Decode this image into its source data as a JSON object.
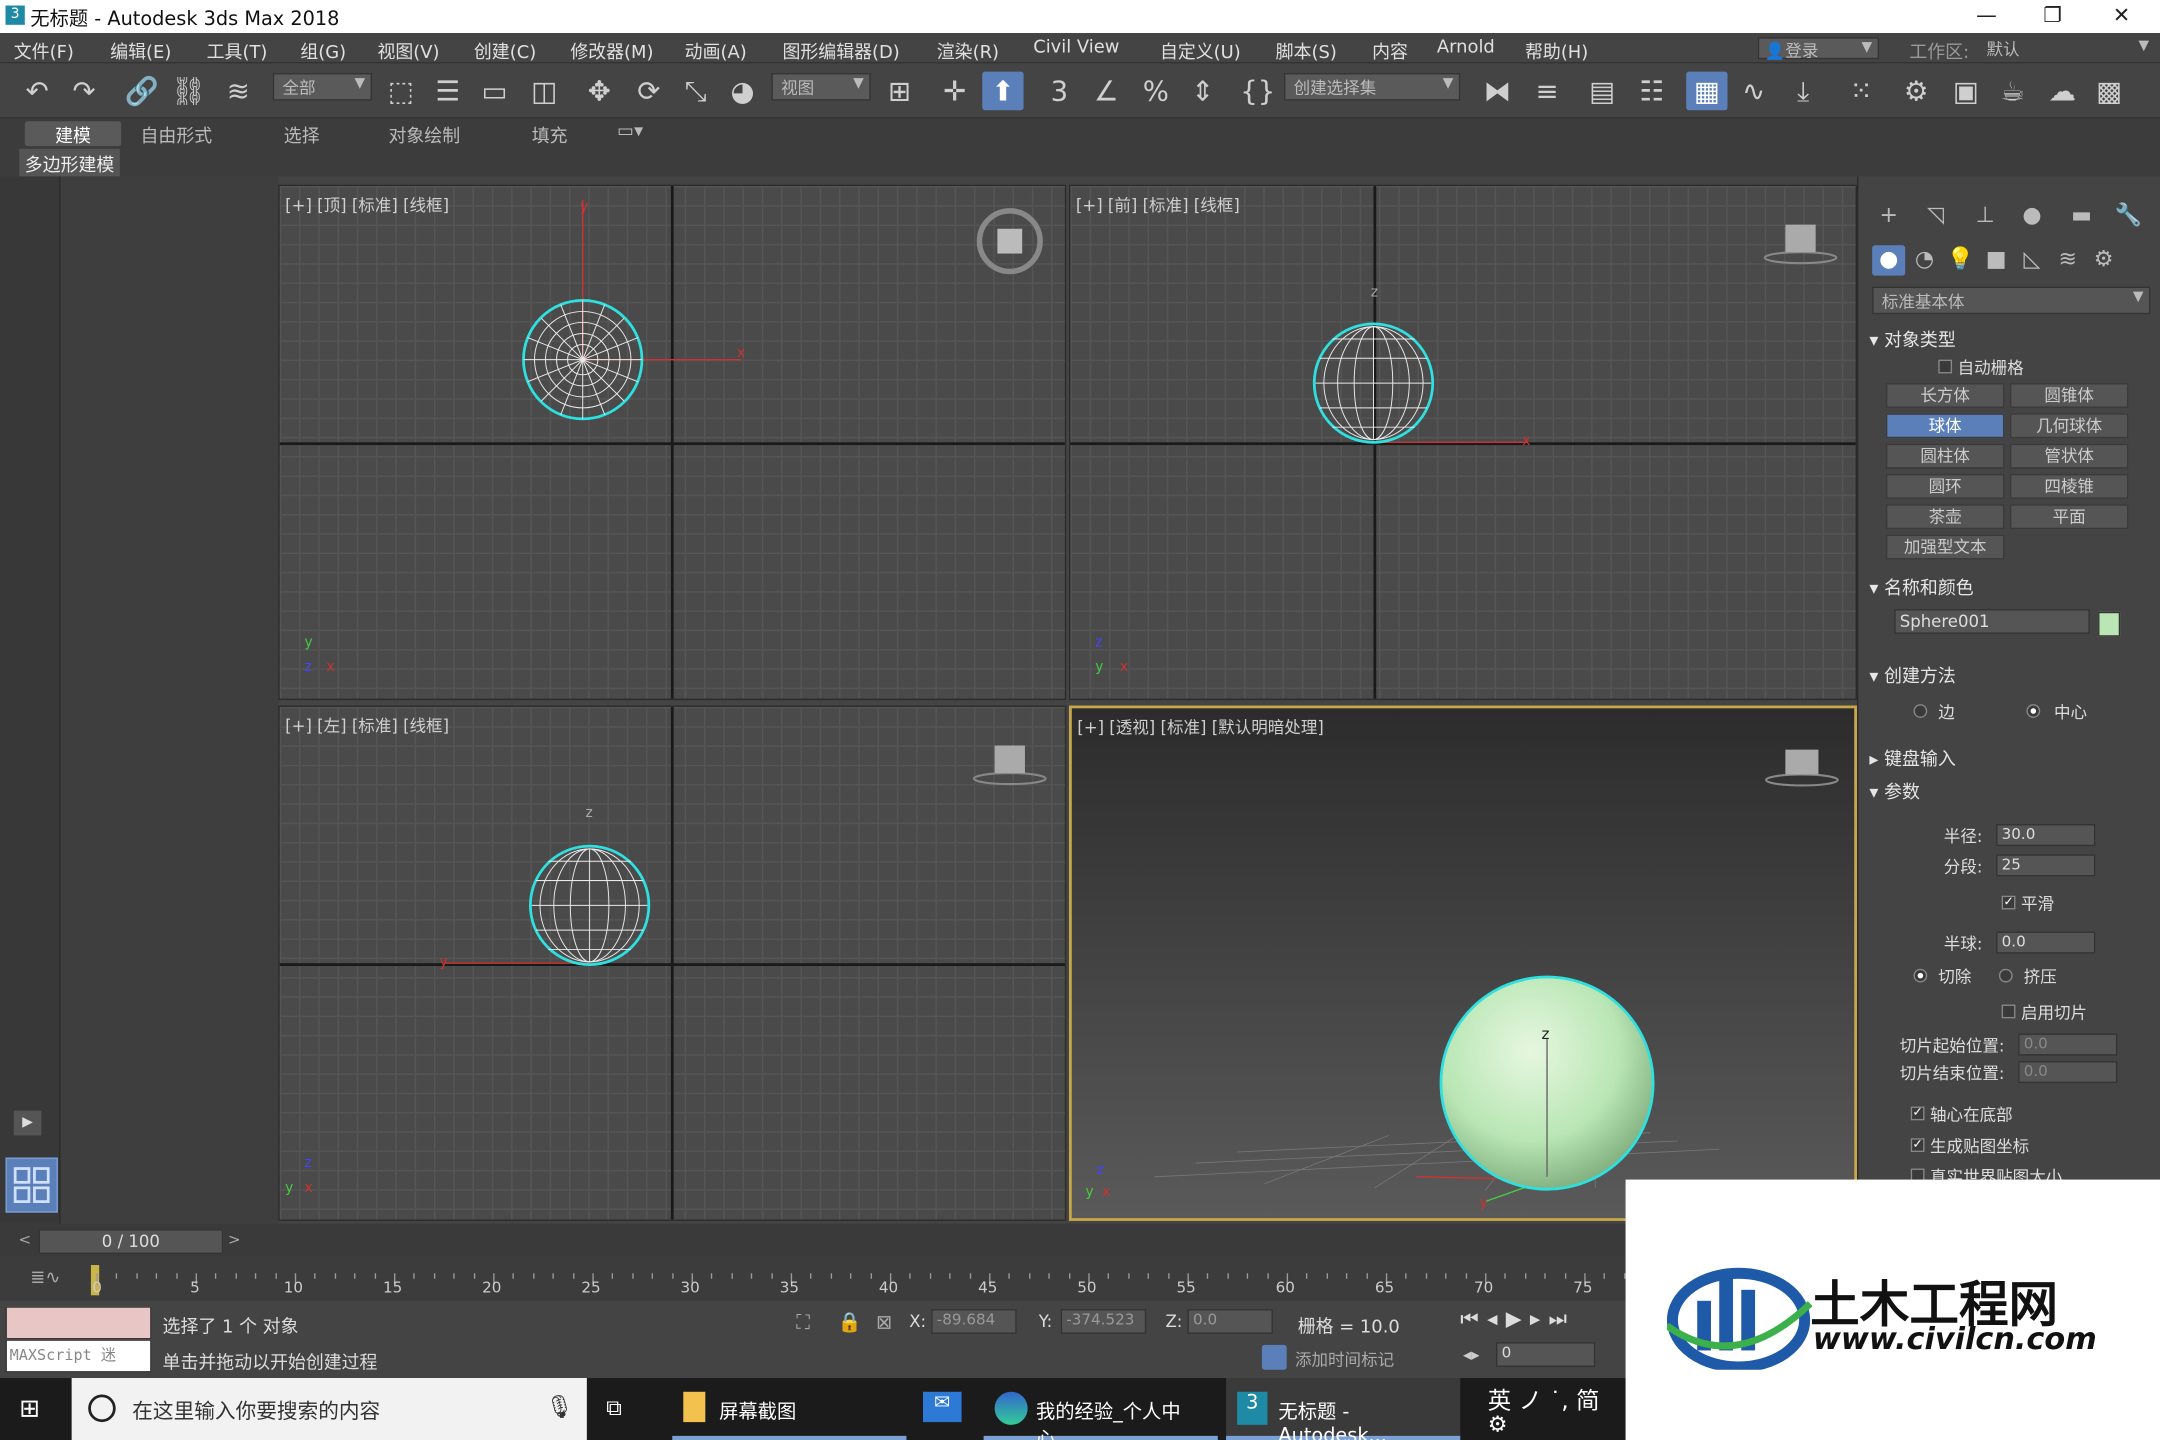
{
  "window": {
    "title": "无标题 - Autodesk 3ds Max 2018",
    "app_icon": "3"
  },
  "menu": [
    "文件(F)",
    "编辑(E)",
    "工具(T)",
    "组(G)",
    "视图(V)",
    "创建(C)",
    "修改器(M)",
    "动画(A)",
    "图形编辑器(D)",
    "渲染(R)",
    "Civil View",
    "自定义(U)",
    "脚本(S)",
    "内容",
    "Arnold",
    "帮助(H)"
  ],
  "account": {
    "login": "登录",
    "workspace_label": "工作区:",
    "workspace_value": "默认"
  },
  "toolbar": {
    "filter_value": "全部",
    "refcoord_value": "视图",
    "selset_placeholder": "创建选择集"
  },
  "ribbon": {
    "tabs": [
      "建模",
      "自由形式",
      "选择",
      "对象绘制",
      "填充"
    ],
    "sub": "多边形建模"
  },
  "viewports": {
    "top": {
      "label": "[+] [顶] [标准] [线框]"
    },
    "front": {
      "label": "[+] [前] [标准] [线框]"
    },
    "left": {
      "label": "[+] [左] [标准] [线框]"
    },
    "persp": {
      "label": "[+] [透视] [标准] [默认明暗处理]"
    }
  },
  "cmd": {
    "category": "标准基本体",
    "obj_type_title": "对象类型",
    "autogrid": "自动栅格",
    "buttons": [
      "长方体",
      "圆锥体",
      "球体",
      "几何球体",
      "圆柱体",
      "管状体",
      "圆环",
      "四棱锥",
      "茶壶",
      "平面",
      "加强型文本"
    ],
    "name_title": "名称和颜色",
    "name_value": "Sphere001",
    "name_color": "#b9e6b4",
    "create_title": "创建方法",
    "create_edge": "边",
    "create_center": "中心",
    "kbd_title": "键盘输入",
    "params_title": "参数",
    "radius_label": "半径:",
    "radius_value": "30.0",
    "segments_label": "分段:",
    "segments_value": "25",
    "smooth": "平滑",
    "hemi_label": "半球:",
    "hemi_value": "0.0",
    "chop": "切除",
    "squash": "挤压",
    "slice_on": "启用切片",
    "slice_from": "切片起始位置:",
    "slice_from_value": "0.0",
    "slice_to": "切片结束位置:",
    "slice_to_value": "0.0",
    "base_pivot": "轴心在底部",
    "gen_uv": "生成贴图坐标",
    "real_world": "真实世界贴图大小"
  },
  "time": {
    "slider": "0 / 100",
    "ticks": [
      "0",
      "5",
      "10",
      "15",
      "20",
      "25",
      "30",
      "35",
      "40",
      "45",
      "50",
      "55",
      "60",
      "65",
      "70",
      "75"
    ]
  },
  "status": {
    "maxscript": "MAXScript 迷",
    "selected": "选择了 1 个 对象",
    "prompt": "单击并拖动以开始创建过程",
    "x_label": "X:",
    "x_value": "-89.684",
    "y_label": "Y:",
    "y_value": "-374.523",
    "z_label": "Z:",
    "z_value": "0.0",
    "grid": "栅格 = 10.0",
    "add_time_tag": "添加时间标记",
    "frame": "0"
  },
  "taskbar": {
    "search": "在这里输入你要搜索的内容",
    "items": [
      "屏幕截图",
      "我的经验_个人中心...",
      "无标题 - Autodesk..."
    ],
    "ime": "英 ノ ˙, 简"
  },
  "watermark": {
    "name": "土木工程网",
    "url": "www.civilcn.com"
  }
}
